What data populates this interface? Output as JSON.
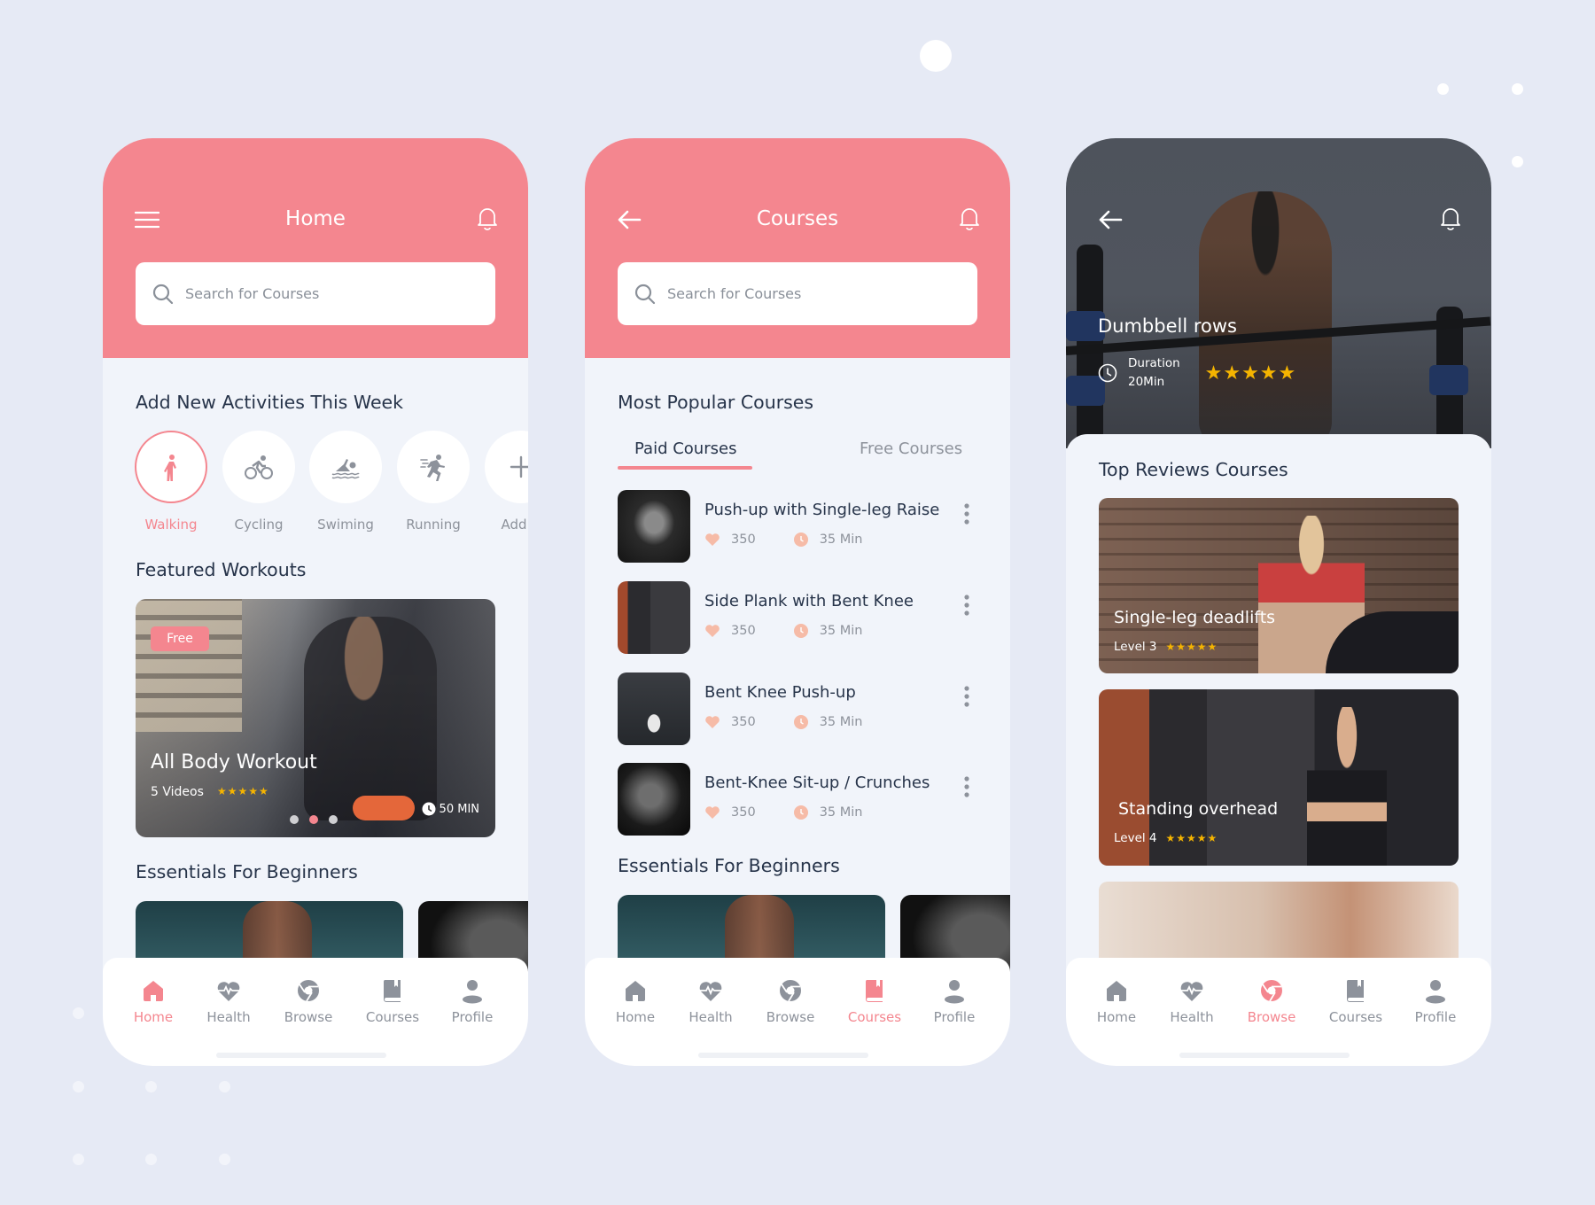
{
  "colors": {
    "accent": "#f4868f",
    "background": "#e6eaf5",
    "text": "#27344a",
    "muted": "#8d929b",
    "star": "#f5b400",
    "meta_icon": "#f6bba7"
  },
  "phone_home": {
    "header": {
      "title": "Home",
      "left_icon": "menu-icon",
      "right_icon": "bell-icon"
    },
    "search": {
      "placeholder": "Search for Courses",
      "value": ""
    },
    "activities_title": "Add New Activities This Week",
    "activities": [
      {
        "label": "Walking",
        "icon": "walking-icon",
        "selected": true
      },
      {
        "label": "Cycling",
        "icon": "cycling-icon",
        "selected": false
      },
      {
        "label": "Swiming",
        "icon": "swimming-icon",
        "selected": false
      },
      {
        "label": "Running",
        "icon": "running-icon",
        "selected": false
      },
      {
        "label": "Add N",
        "icon": "plus-icon",
        "selected": false
      }
    ],
    "featured_title": "Featured Workouts",
    "featured": {
      "badge": "Free",
      "title": "All Body Workout",
      "videos": "5 Videos",
      "rating": 5,
      "stars": "★★★★★",
      "duration": "50 MIN",
      "page": 2,
      "pages": 3
    },
    "essentials_title": "Essentials For Beginners"
  },
  "phone_courses": {
    "header": {
      "title": "Courses",
      "left_icon": "back-arrow-icon",
      "right_icon": "bell-icon"
    },
    "search": {
      "placeholder": "Search for Courses",
      "value": ""
    },
    "section_title": "Most Popular Courses",
    "tabs": [
      {
        "label": "Paid Courses",
        "active": true
      },
      {
        "label": "Free Courses",
        "active": false
      }
    ],
    "courses": [
      {
        "title": "Push-up with Single-leg Raise",
        "likes": "350",
        "duration": "35 Min"
      },
      {
        "title": "Side Plank with Bent Knee",
        "likes": "350",
        "duration": "35 Min"
      },
      {
        "title": "Bent Knee Push-up",
        "likes": "350",
        "duration": "35 Min"
      },
      {
        "title": "Bent-Knee Sit-up / Crunches",
        "likes": "350",
        "duration": "35 Min"
      }
    ],
    "essentials_title": "Essentials For Beginners"
  },
  "phone_browse": {
    "header": {
      "left_icon": "back-arrow-icon",
      "right_icon": "bell-icon"
    },
    "hero": {
      "title": "Dumbbell rows",
      "duration_label": "Duration",
      "duration_value": "20Min",
      "rating": 5,
      "stars": "★★★★★"
    },
    "section_title": "Top Reviews Courses",
    "cards": [
      {
        "title": "Single-leg deadlifts",
        "level": "Level 3",
        "rating": 5,
        "stars": "★★★★★"
      },
      {
        "title": "Standing overhead",
        "level": "Level 4",
        "rating": 5,
        "stars": "★★★★★"
      }
    ]
  },
  "nav": {
    "items": [
      {
        "label": "Home",
        "icon": "home-icon"
      },
      {
        "label": "Health",
        "icon": "heart-pulse-icon"
      },
      {
        "label": "Browse",
        "icon": "browse-icon"
      },
      {
        "label": "Courses",
        "icon": "book-icon"
      },
      {
        "label": "Profile",
        "icon": "profile-icon"
      }
    ],
    "active": {
      "phone_home": "Home",
      "phone_courses": "Courses",
      "phone_browse": "Browse"
    }
  }
}
